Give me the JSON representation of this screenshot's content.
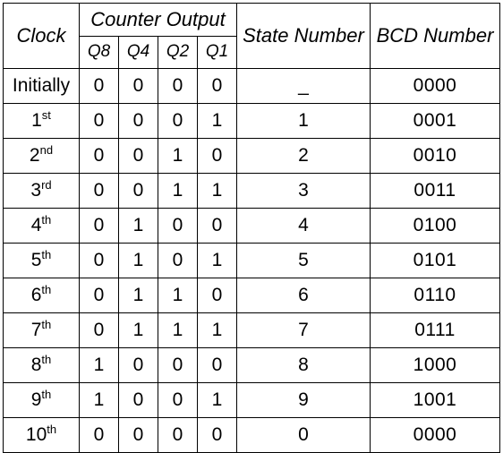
{
  "table": {
    "headers": {
      "clock": "Clock",
      "counter_output": "Counter Output",
      "q8": "Q8",
      "q4": "Q4",
      "q2": "Q2",
      "q1": "Q1",
      "state_number": "State Number",
      "bcd_number": "BCD Number"
    },
    "rows": [
      {
        "clock": "Initially",
        "clock_sup": "",
        "q8": "0",
        "q4": "0",
        "q2": "0",
        "q1": "0",
        "state": "_",
        "bcd": "0000"
      },
      {
        "clock": "1",
        "clock_sup": "st",
        "q8": "0",
        "q4": "0",
        "q2": "0",
        "q1": "1",
        "state": "1",
        "bcd": "0001"
      },
      {
        "clock": "2",
        "clock_sup": "nd",
        "q8": "0",
        "q4": "0",
        "q2": "1",
        "q1": "0",
        "state": "2",
        "bcd": "0010"
      },
      {
        "clock": "3",
        "clock_sup": "rd",
        "q8": "0",
        "q4": "0",
        "q2": "1",
        "q1": "1",
        "state": "3",
        "bcd": "0011"
      },
      {
        "clock": "4",
        "clock_sup": "th",
        "q8": "0",
        "q4": "1",
        "q2": "0",
        "q1": "0",
        "state": "4",
        "bcd": "0100"
      },
      {
        "clock": "5",
        "clock_sup": "th",
        "q8": "0",
        "q4": "1",
        "q2": "0",
        "q1": "1",
        "state": "5",
        "bcd": "0101"
      },
      {
        "clock": "6",
        "clock_sup": "th",
        "q8": "0",
        "q4": "1",
        "q2": "1",
        "q1": "0",
        "state": "6",
        "bcd": "0110"
      },
      {
        "clock": "7",
        "clock_sup": "th",
        "q8": "0",
        "q4": "1",
        "q2": "1",
        "q1": "1",
        "state": "7",
        "bcd": "0111"
      },
      {
        "clock": "8",
        "clock_sup": "th",
        "q8": "1",
        "q4": "0",
        "q2": "0",
        "q1": "0",
        "state": "8",
        "bcd": "1000"
      },
      {
        "clock": "9",
        "clock_sup": "th",
        "q8": "1",
        "q4": "0",
        "q2": "0",
        "q1": "1",
        "state": "9",
        "bcd": "1001"
      },
      {
        "clock": "10",
        "clock_sup": "th",
        "q8": "0",
        "q4": "0",
        "q2": "0",
        "q1": "0",
        "state": "0",
        "bcd": "0000"
      }
    ]
  },
  "colors": {
    "border": "#000000",
    "text": "#000000",
    "background": "#ffffff"
  }
}
